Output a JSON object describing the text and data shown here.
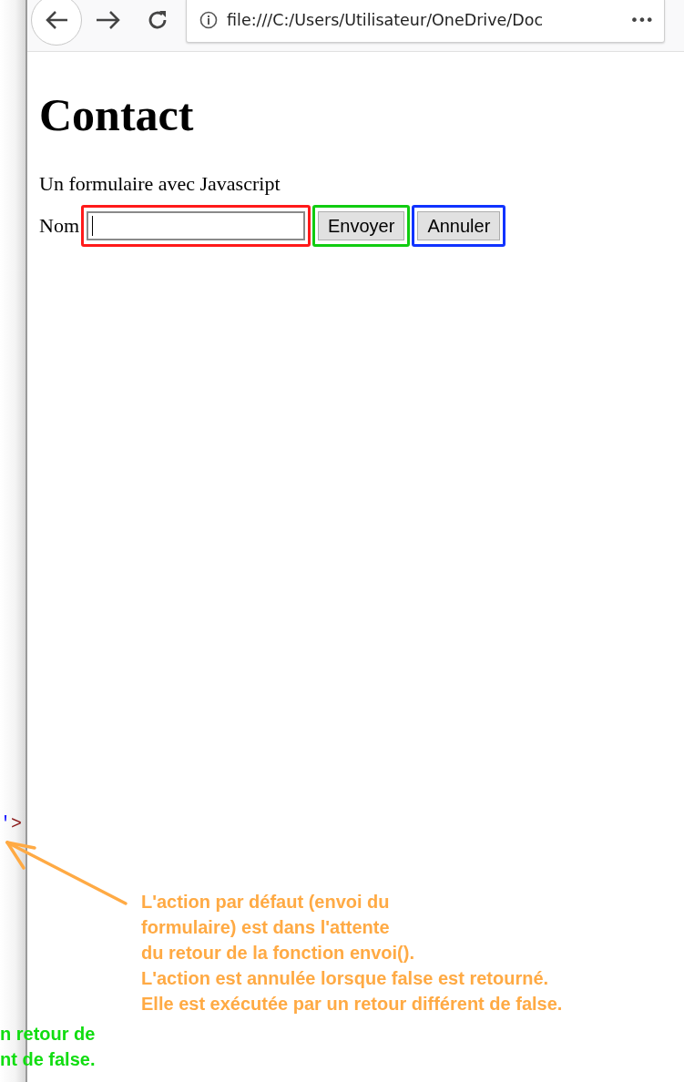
{
  "browser": {
    "url": "file:///C:/Users/Utilisateur/OneDrive/Doc",
    "menu": "•••"
  },
  "page": {
    "title": "Contact",
    "subtitle": "Un formulaire avec Javascript",
    "form": {
      "label": "Nom",
      "controls": [
        {
          "kind": "field",
          "focused": true,
          "color": "#ff1a1a"
        },
        {
          "kind": "button",
          "label": "Envoyer",
          "color": "#11cc11"
        },
        {
          "kind": "button",
          "label": "Annuler",
          "color": "#1133ff"
        }
      ]
    }
  },
  "code_fragment": {
    "quote": "'",
    "bracket": ">"
  },
  "orange_note": {
    "lines": [
      "L'action par défaut (envoi du",
      "formulaire) est dans l'attente",
      "du retour de la fonction envoi().",
      "L'action est annulée lorsque false est retourné.",
      "Elle est exécutée par un retour différent de false."
    ]
  },
  "green_note": {
    "lines": [
      "n retour de",
      "nt de false."
    ]
  }
}
